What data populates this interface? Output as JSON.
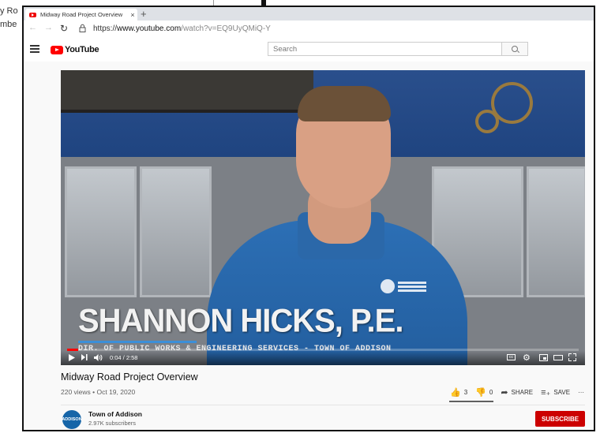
{
  "background": {
    "text_line_1": "y Ro",
    "text_line_2": "mbe"
  },
  "browser": {
    "tab_title": "Midway Road Project Overview",
    "tab_close": "×",
    "new_tab": "+",
    "back": "←",
    "forward": "→",
    "reload": "↻",
    "url_scheme": "https://",
    "url_host": "www.youtube.com",
    "url_path": "/watch?v=EQ9UyQMiQ-Y"
  },
  "youtube": {
    "logo_text": "YouTube",
    "search_placeholder": "Search"
  },
  "player": {
    "lower_third_name": "SHANNON HICKS, P.E.",
    "lower_third_subtitle": "DIR. OF PUBLIC WORKS & ENGINEERING SERVICES - TOWN OF ADDISON",
    "time": "0:04 / 2:58",
    "progress_fraction": 0.022,
    "cc_label": "cc",
    "colors": {
      "progress": "#ff0000",
      "accent": "#3c8fd8"
    }
  },
  "video": {
    "title": "Midway Road Project Overview",
    "meta": "220 views • Oct 19, 2020",
    "likes": "3",
    "dislikes": "0",
    "share_label": "SHARE",
    "save_label": "SAVE",
    "more_label": "···"
  },
  "channel": {
    "avatar_text": "ADDISON",
    "name": "Town of Addison",
    "subscribers": "2.97K subscribers",
    "subscribe_label": "SUBSCRIBE",
    "subscribe_color": "#cc0000"
  }
}
